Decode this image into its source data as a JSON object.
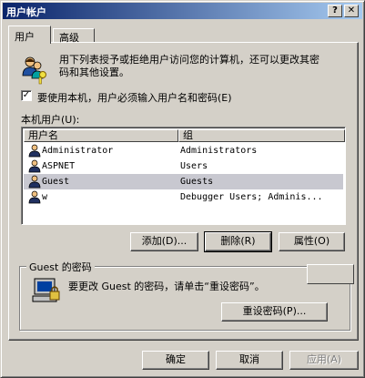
{
  "window": {
    "title": "用户帐户"
  },
  "titlebar": {
    "help_glyph": "?",
    "close_glyph": "✕"
  },
  "tabs": [
    {
      "label": "用户"
    },
    {
      "label": "高级"
    }
  ],
  "intro": {
    "text_line1": "用下列表授予或拒绝用户访问您的计算机，还可以更改其密",
    "text_line2": "码和其他设置。"
  },
  "require_password": {
    "label": "要使用本机，用户必须输入用户名和密码(E)",
    "checked": true,
    "check_glyph": "✓"
  },
  "users_section": {
    "label": "本机用户(U):"
  },
  "users_list": {
    "columns": [
      "用户名",
      "组"
    ],
    "rows": [
      {
        "name": "Administrator",
        "group": "Administrators",
        "selected": false
      },
      {
        "name": "ASPNET",
        "group": "Users",
        "selected": false
      },
      {
        "name": "Guest",
        "group": "Guests",
        "selected": true
      },
      {
        "name": "w",
        "group": "Debugger Users; Adminis...",
        "selected": false
      }
    ]
  },
  "list_buttons": {
    "add": "添加(D)...",
    "remove": "删除(R)",
    "properties": "属性(O)"
  },
  "password_group": {
    "title": "Guest 的密码",
    "text": "要更改 Guest 的密码，请单击“重设密码”。",
    "reset_button": "重设密码(P)..."
  },
  "dialog_buttons": {
    "ok": "确定",
    "cancel": "取消",
    "apply": "应用(A)"
  },
  "colors": {
    "titlebar_start": "#0a246a",
    "titlebar_end": "#a6caf0",
    "face": "#d4d0c8",
    "selection": "#c8c8d0"
  }
}
